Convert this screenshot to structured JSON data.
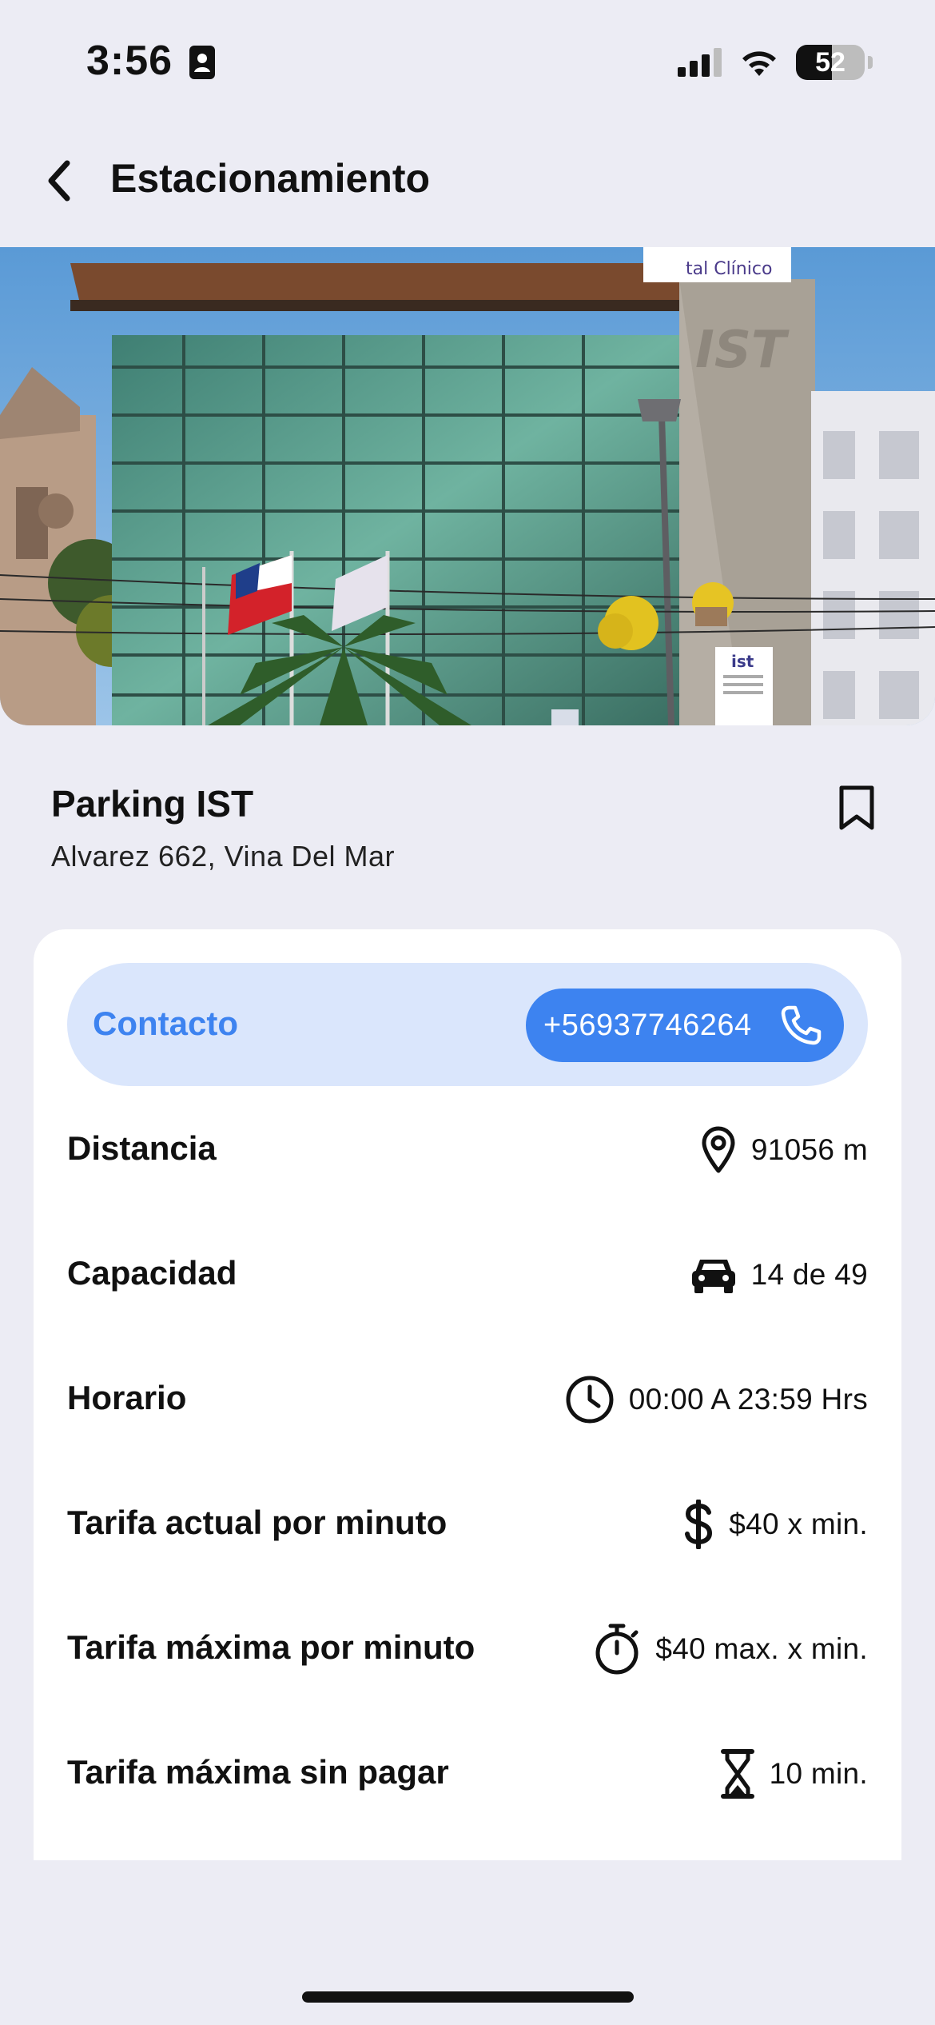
{
  "status": {
    "time": "3:56",
    "battery": "52",
    "battery_level": 0.52
  },
  "header": {
    "title": "Estacionamiento"
  },
  "place": {
    "name": "Parking IST",
    "address": "Alvarez 662, Vina Del Mar"
  },
  "hero_image": {
    "sign_text": "tal Clínico",
    "facade_text": "IST",
    "small_sign": "ist"
  },
  "contact": {
    "label": "Contacto",
    "phone": "+56937746264"
  },
  "details": [
    {
      "label": "Distancia",
      "value": "91056 m",
      "icon": "location-pin-icon"
    },
    {
      "label": "Capacidad",
      "value": "14 de 49",
      "icon": "car-icon"
    },
    {
      "label": "Horario",
      "value": "00:00 A 23:59 Hrs",
      "icon": "clock-icon"
    },
    {
      "label": "Tarifa actual por minuto",
      "value": "$40 x min.",
      "icon": "dollar-icon"
    },
    {
      "label": "Tarifa máxima por minuto",
      "value": "$40 max. x min.",
      "icon": "stopwatch-icon"
    },
    {
      "label": "Tarifa máxima sin pagar",
      "value": "10 min.",
      "icon": "hourglass-icon"
    }
  ],
  "colors": {
    "background": "#ECECF4",
    "accent": "#3D83F0",
    "contact_bg": "#DAE6FC"
  }
}
